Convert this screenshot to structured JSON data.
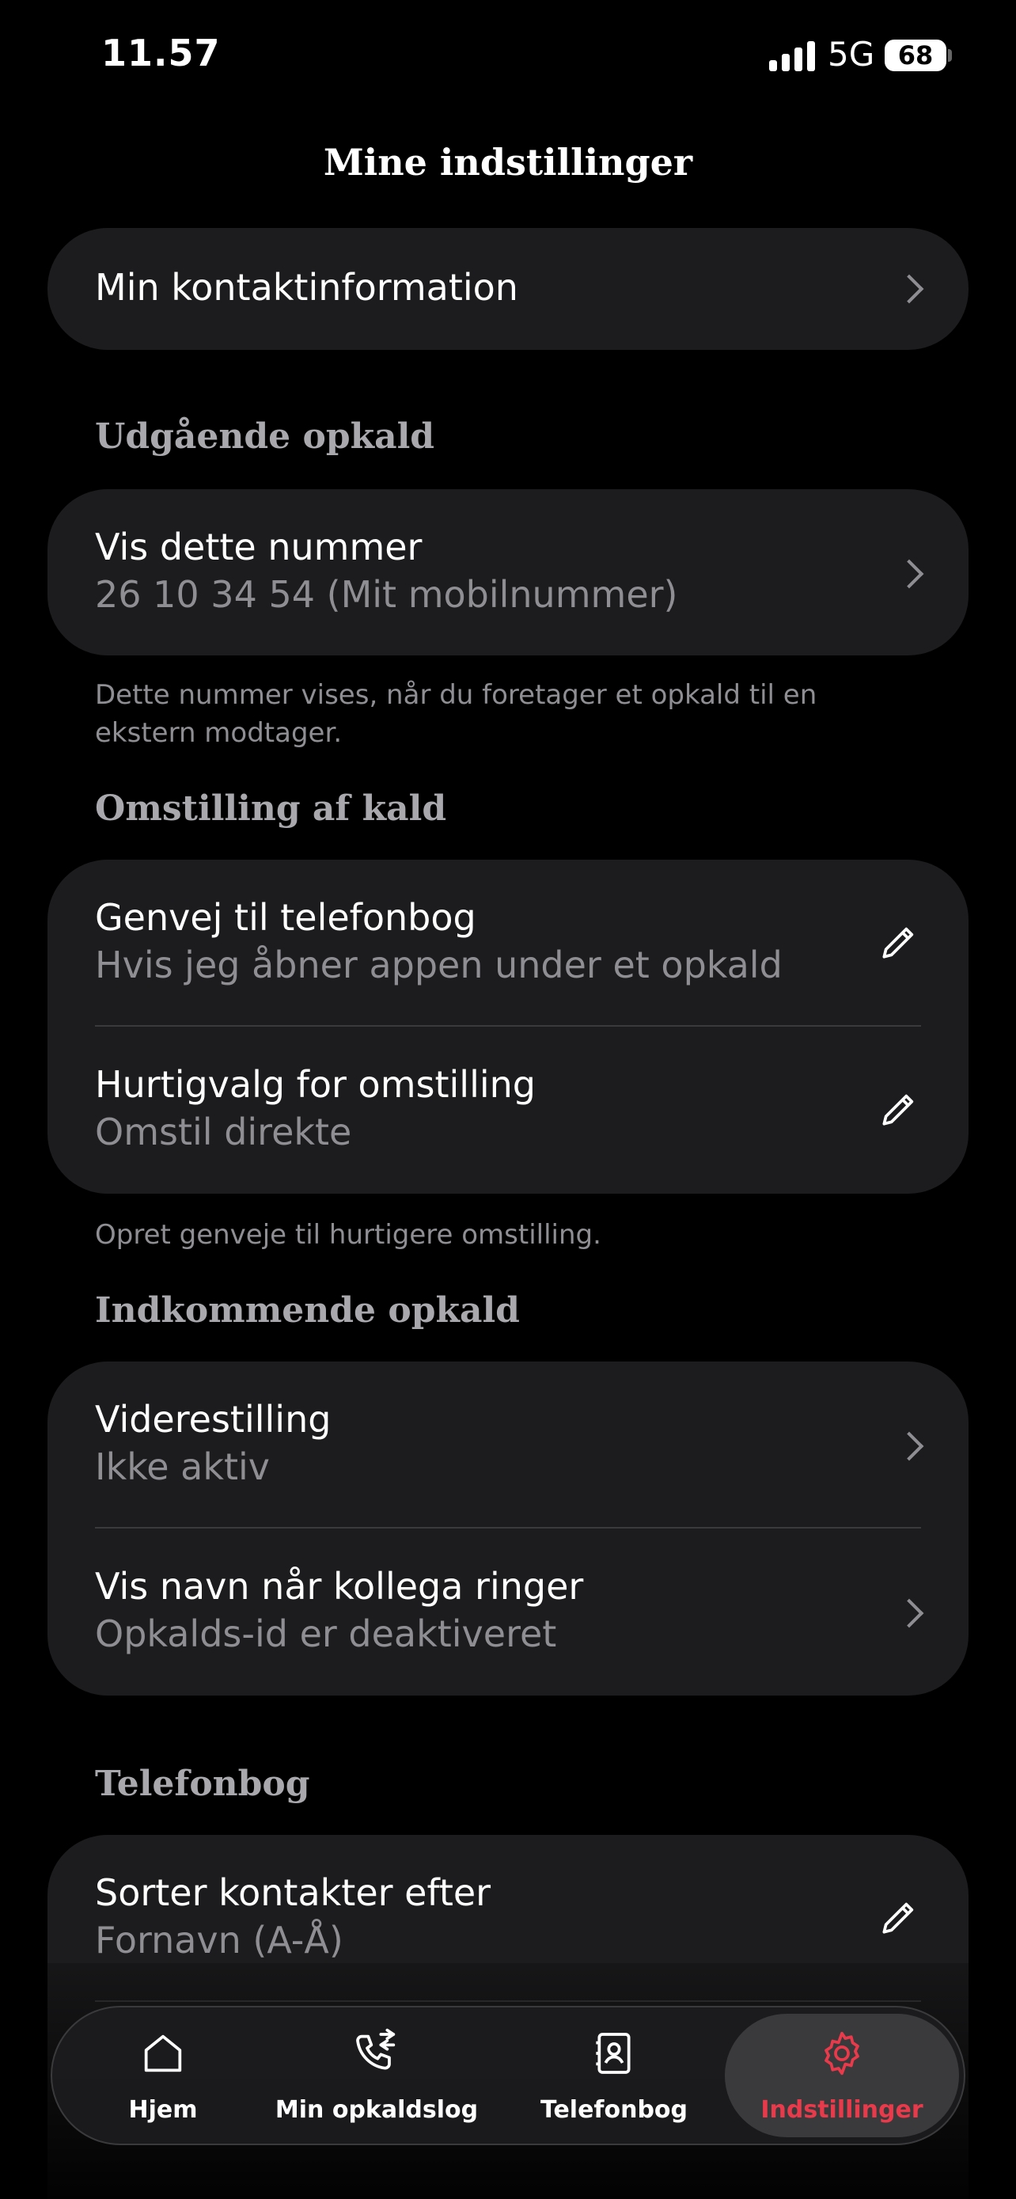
{
  "status_bar": {
    "time": "11.57",
    "network": "5G",
    "battery": "68"
  },
  "page_title": "Mine indstillinger",
  "contact_card": {
    "label": "Min kontaktinformation"
  },
  "outgoing": {
    "header": "Udgående opkald",
    "show_number_title": "Vis dette nummer",
    "show_number_value": "26 10 34 54 (Mit mobilnummer)",
    "footnote": "Dette nummer vises, når du foretager et opkald til en ekstern modtager."
  },
  "transfer": {
    "header": "Omstilling af kald",
    "shortcut_title": "Genvej til telefonbog",
    "shortcut_value": "Hvis jeg åbner appen under et opkald",
    "quickdial_title": "Hurtigvalg for omstilling",
    "quickdial_value": "Omstil direkte",
    "footnote": "Opret genveje til hurtigere omstilling."
  },
  "incoming": {
    "header": "Indkommende opkald",
    "forwarding_title": "Viderestilling",
    "forwarding_value": "Ikke aktiv",
    "colleague_title": "Vis navn når kollega ringer",
    "colleague_value": "Opkalds-id er deaktiveret"
  },
  "phonebook": {
    "header": "Telefonbog",
    "sort_title": "Sorter kontakter efter",
    "sort_value": "Fornavn (A-Å)"
  },
  "tab_bar": {
    "tabs": [
      {
        "label": "Hjem",
        "icon": "home-icon"
      },
      {
        "label": "Min opkaldslog",
        "icon": "call-log-icon"
      },
      {
        "label": "Telefonbog",
        "icon": "phonebook-icon"
      },
      {
        "label": "Indstillinger",
        "icon": "gear-icon"
      }
    ],
    "active_color": "#e83a4a"
  }
}
